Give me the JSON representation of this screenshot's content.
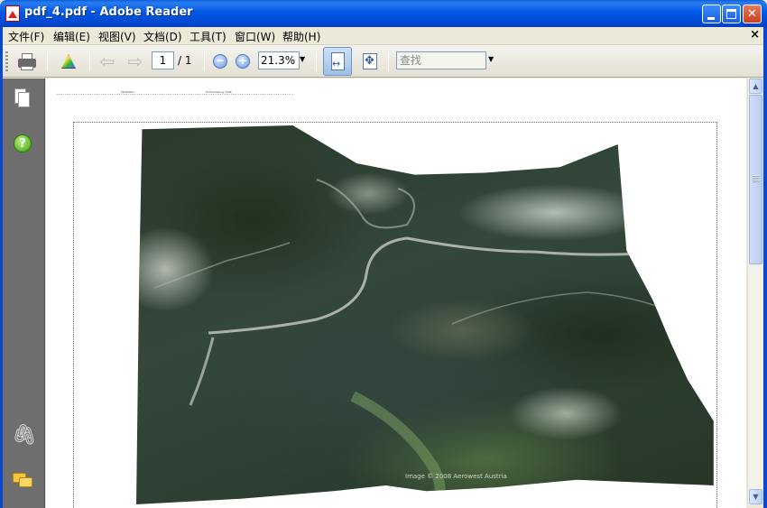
{
  "window": {
    "title": "pdf_4.pdf - Adobe Reader",
    "minimize_label": "_",
    "maximize_label": "□",
    "close_label": "✕"
  },
  "menu": {
    "items": [
      "文件(F)",
      "编辑(E)",
      "视图(V)",
      "文档(D)",
      "工具(T)",
      "窗口(W)",
      "帮助(H)"
    ],
    "close_doc": "×"
  },
  "toolbar": {
    "page_current": "1",
    "page_total": "/ 1",
    "zoom_value": "21.3%",
    "zoom_out_label": "−",
    "zoom_in_label": "+",
    "search_placeholder": "查找",
    "prev_glyph": "⇦",
    "next_glyph": "⇨",
    "dropdown_glyph": "▼"
  },
  "nav": {
    "help_label": "?",
    "attach_glyph": "🖇"
  },
  "document": {
    "header_left": "PEOPORO",
    "header_right": "Hof/Seilsberg 2008",
    "map_caption": "Image © 2008 Aerowest Austria"
  },
  "scrollbar": {
    "up_glyph": "▲",
    "down_glyph": "▼"
  },
  "colors": {
    "titlebar": "#0058e6",
    "panel": "#6e6e6e",
    "close_button": "#c9401f"
  }
}
